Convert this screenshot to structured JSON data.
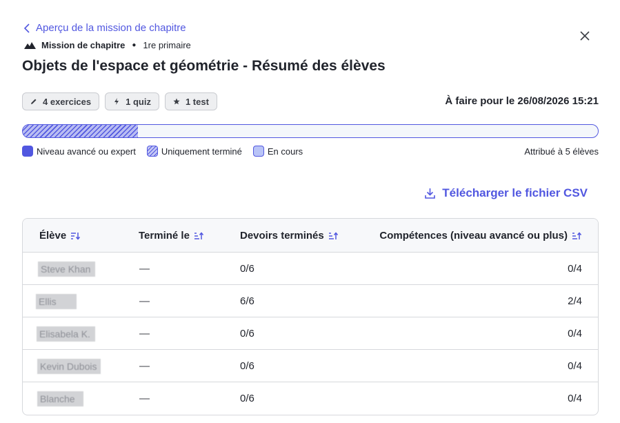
{
  "header": {
    "back_label": "Aperçu de la mission de chapitre",
    "mission_label": "Mission de chapitre",
    "grade": "1re primaire",
    "title": "Objets de l'espace et géométrie - Résumé des élèves"
  },
  "pills": [
    {
      "icon": "pencil-icon",
      "label": "4 exercices"
    },
    {
      "icon": "lightning-icon",
      "label": "1 quiz"
    },
    {
      "icon": "star-icon",
      "label": "1 test"
    }
  ],
  "due": "À faire pour le 26/08/2026 15:21",
  "progress": {
    "completed_fraction": 0.2,
    "advanced_fraction": 0.0,
    "in_progress_fraction": 0.0
  },
  "legend": {
    "advanced": "Niveau avancé ou expert",
    "completed": "Uniquement terminé",
    "in_progress": "En cours"
  },
  "assigned": "Attribué à 5 élèves",
  "csv_label": "Télécharger le fichier CSV",
  "table": {
    "headers": {
      "student": "Élève",
      "completed_on": "Terminé le",
      "homework": "Devoirs terminés",
      "skills": "Compétences (niveau avancé ou plus)"
    },
    "rows": [
      {
        "name": "Steve Khan",
        "completed_on": "—",
        "homework": "0/6",
        "skills": "0/4"
      },
      {
        "name": "Ellis",
        "completed_on": "—",
        "homework": "6/6",
        "skills": "2/4"
      },
      {
        "name": "Elisabela K.",
        "completed_on": "—",
        "homework": "0/6",
        "skills": "0/4"
      },
      {
        "name": "Kevin Dubois",
        "completed_on": "—",
        "homework": "0/6",
        "skills": "0/4"
      },
      {
        "name": "Blanche",
        "completed_on": "—",
        "homework": "0/6",
        "skills": "0/4"
      }
    ]
  },
  "colors": {
    "accent": "#5157e0",
    "text": "#21242c",
    "border": "#d6d8dc"
  }
}
